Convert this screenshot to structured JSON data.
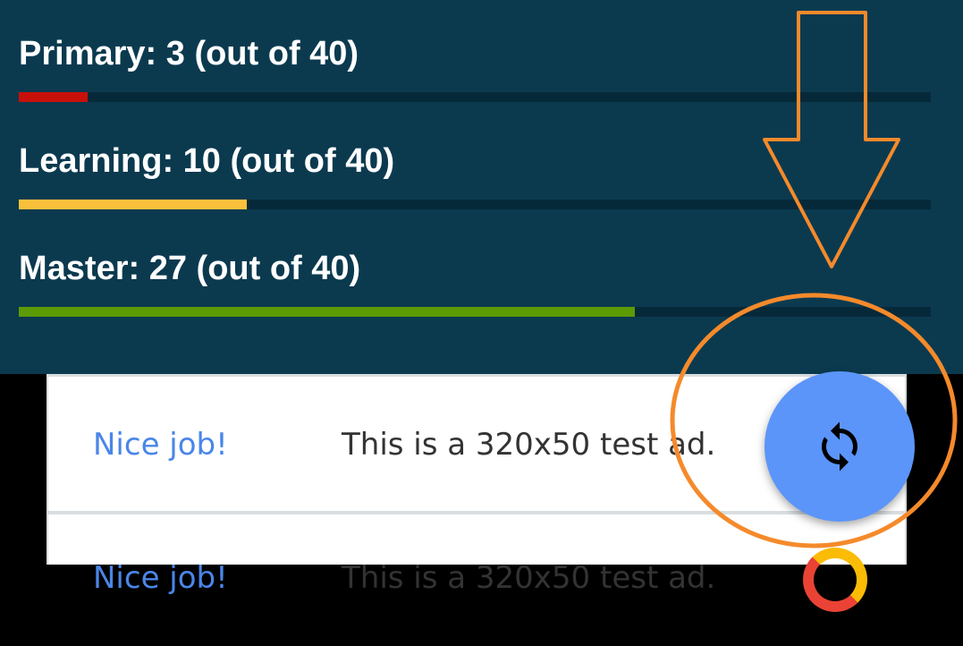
{
  "stats": [
    {
      "label": "Primary: 3 (out of 40)",
      "value": 3,
      "total": 40,
      "color": "#c8100a"
    },
    {
      "label": "Learning: 10 (out of 40)",
      "value": 10,
      "total": 40,
      "color": "#fbc03b"
    },
    {
      "label": "Master: 27 (out of 40)",
      "value": 27,
      "total": 40,
      "color": "#5c9a06"
    }
  ],
  "ads": [
    {
      "headline": "Nice job!",
      "body": "This is a 320x50 test ad."
    },
    {
      "headline": "Nice job!",
      "body": "This is a 320x50 test ad."
    }
  ],
  "fab": {
    "icon": "refresh-icon",
    "color": "#5b95f9"
  },
  "annotation": {
    "color": "#f58a2b",
    "shapes": [
      "down-arrow",
      "ellipse"
    ]
  }
}
